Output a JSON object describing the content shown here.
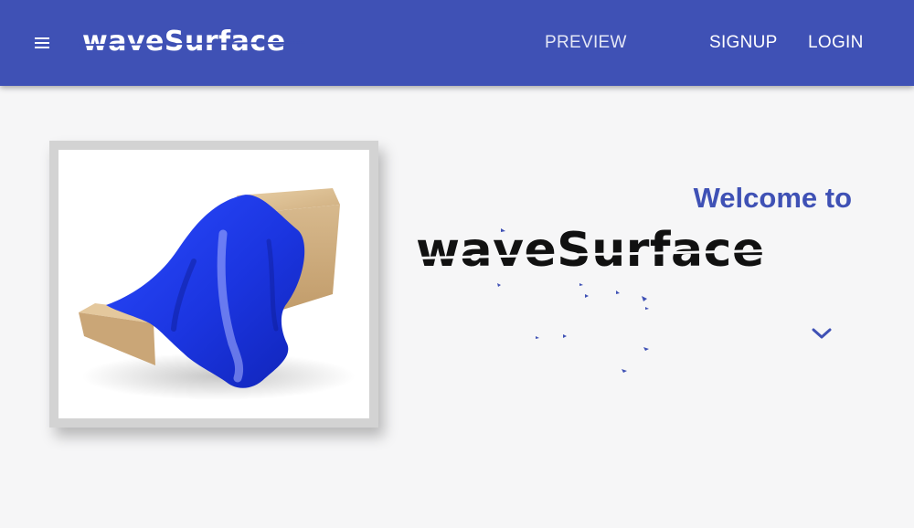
{
  "appbar": {
    "menu_icon": "hamburger-menu-icon",
    "brand": "waveSurface",
    "nav": {
      "preview": "PREVIEW",
      "signup": "SIGNUP",
      "login": "LOGIN"
    }
  },
  "hero": {
    "image_subject": "blue cloth draped over a cardboard box",
    "welcome": "Welcome to",
    "logo": "waveSurface",
    "scroll_icon": "chevron-down-icon"
  },
  "colors": {
    "primary": "#3f51b5",
    "background": "#f6f6f7",
    "cloth": "#1f3fe6",
    "box": "#d9bc92"
  }
}
